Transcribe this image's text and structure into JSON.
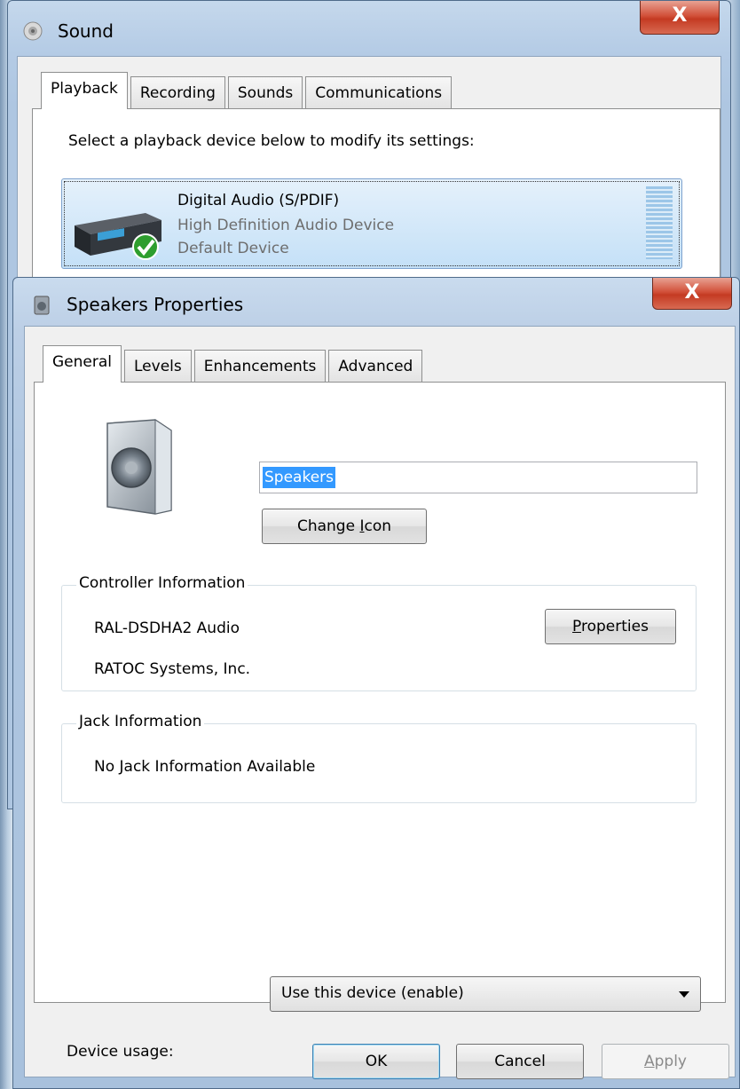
{
  "sound": {
    "title": "Sound",
    "close": "X",
    "tabs": [
      "Playback",
      "Recording",
      "Sounds",
      "Communications"
    ],
    "instruction": "Select a playback device below to modify its settings:",
    "device": {
      "name": "Digital Audio (S/PDIF)",
      "driver": "High Definition Audio Device",
      "status": "Default Device"
    }
  },
  "props": {
    "title": "Speakers Properties",
    "close": "X",
    "tabs": [
      "General",
      "Levels",
      "Enhancements",
      "Advanced"
    ],
    "name_value": "Speakers",
    "change_icon_pre": "Change ",
    "change_icon_key": "I",
    "change_icon_post": "con",
    "controller": {
      "title": "Controller Information",
      "name": "RAL-DSDHA2 Audio",
      "vendor": "RATOC Systems, Inc.",
      "properties_key": "P",
      "properties_rest": "roperties"
    },
    "jack": {
      "title": "Jack Information",
      "text": "No Jack Information Available"
    },
    "usage": {
      "label": "Device usage:",
      "value": "Use this device (enable)"
    },
    "buttons": {
      "ok": "OK",
      "cancel": "Cancel",
      "apply_key": "A",
      "apply_rest": "pply"
    }
  }
}
